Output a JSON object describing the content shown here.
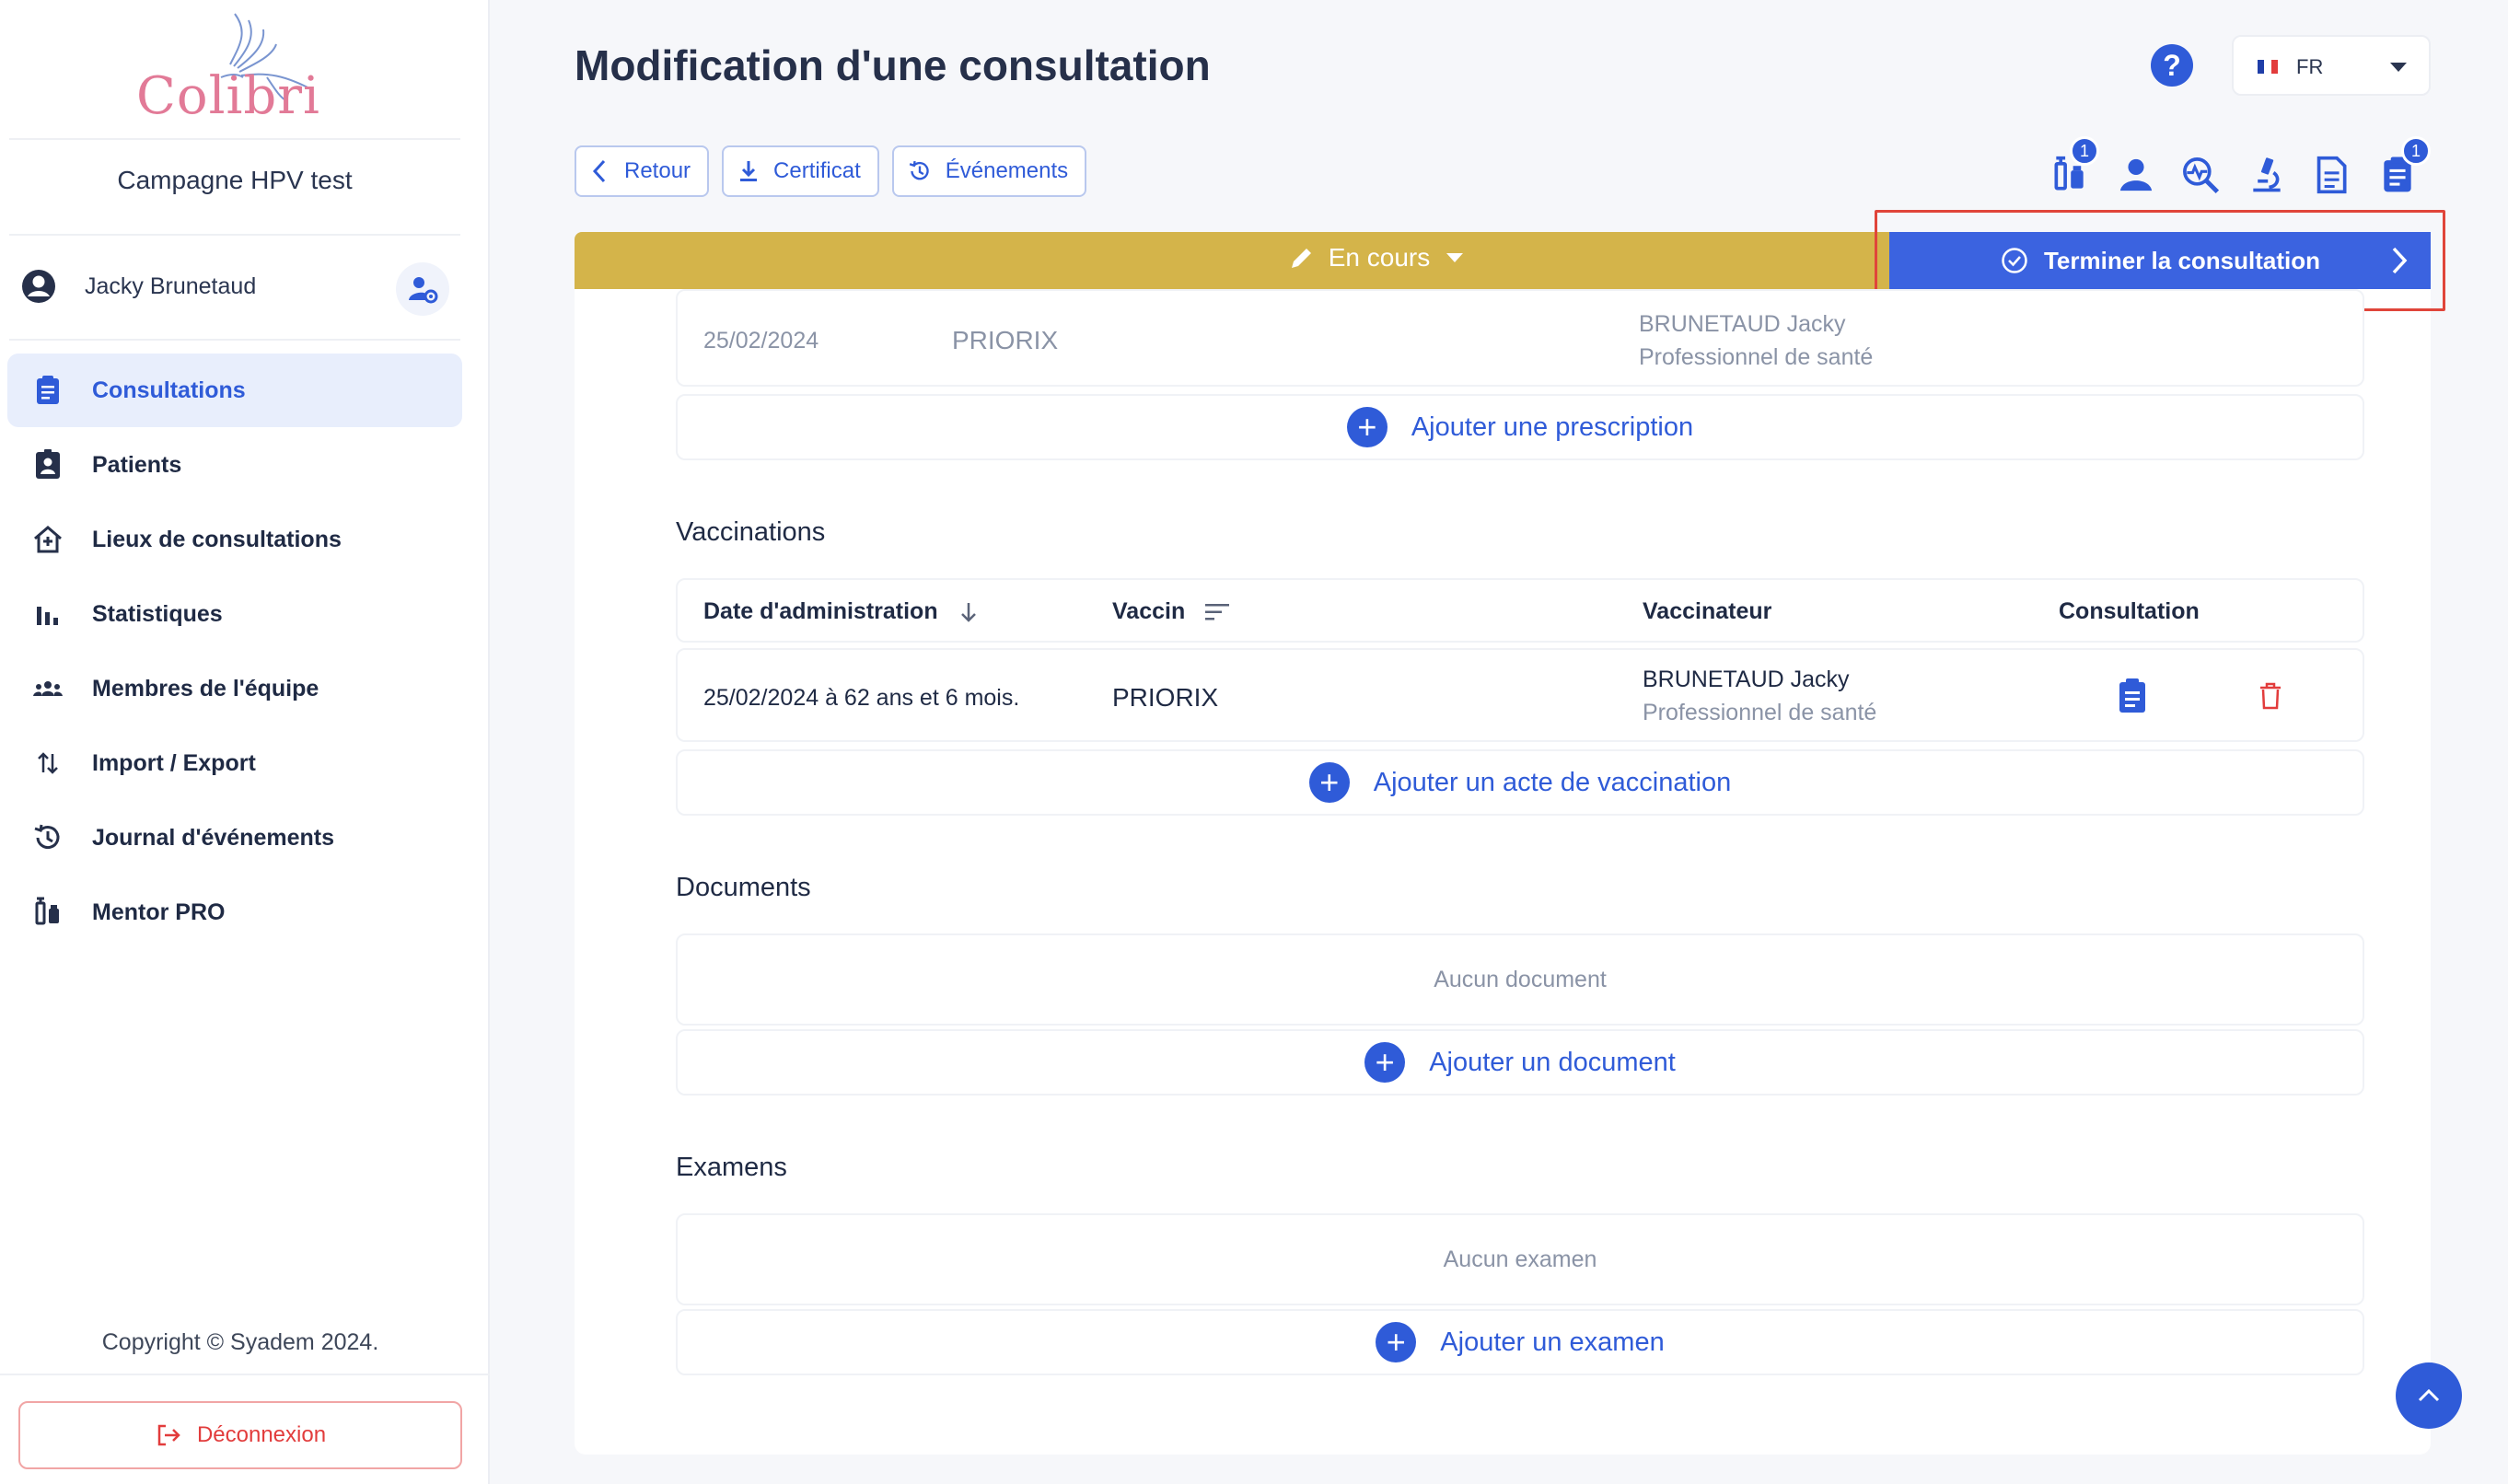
{
  "app": {
    "logo_text": "Colibri",
    "campaign": "Campagne HPV test"
  },
  "user": {
    "name": "Jacky Brunetaud"
  },
  "nav": {
    "items": [
      {
        "label": "Consultations",
        "icon": "clipboard-icon",
        "active": true
      },
      {
        "label": "Patients",
        "icon": "patient-badge-icon",
        "active": false
      },
      {
        "label": "Lieux de consultations",
        "icon": "house-plus-icon",
        "active": false
      },
      {
        "label": "Statistiques",
        "icon": "bar-chart-icon",
        "active": false
      },
      {
        "label": "Membres de l'équipe",
        "icon": "team-icon",
        "active": false
      },
      {
        "label": "Import / Export",
        "icon": "arrows-up-down-icon",
        "active": false
      },
      {
        "label": "Journal d'événements",
        "icon": "history-icon",
        "active": false
      },
      {
        "label": "Mentor PRO",
        "icon": "vaccine-icon",
        "active": false
      }
    ]
  },
  "footer": {
    "copyright": "Copyright © Syadem 2024.",
    "logout": "Déconnexion"
  },
  "header": {
    "title": "Modification d'une consultation",
    "help": "?",
    "language": "FR"
  },
  "toolbar": {
    "back": "Retour",
    "certificate": "Certificat",
    "events": "Événements"
  },
  "top_icons": {
    "vaccine_badge": "1",
    "document_badge": "1"
  },
  "status": {
    "label": "En cours",
    "finish": "Terminer la consultation"
  },
  "prescription": {
    "date": "25/02/2024",
    "vaccine": "PRIORIX",
    "prescriber": "BRUNETAUD Jacky",
    "role": "Professionnel de santé",
    "add": "Ajouter une prescription"
  },
  "vaccinations": {
    "title": "Vaccinations",
    "headers": {
      "date": "Date d'administration",
      "vaccine": "Vaccin",
      "vaccinator": "Vaccinateur",
      "consultation": "Consultation"
    },
    "rows": [
      {
        "date": "25/02/2024 à 62 ans et 6 mois.",
        "vaccine": "PRIORIX",
        "vaccinator": "BRUNETAUD Jacky",
        "role": "Professionnel de santé"
      }
    ],
    "add": "Ajouter un acte de vaccination"
  },
  "documents": {
    "title": "Documents",
    "empty": "Aucun document",
    "add": "Ajouter un document"
  },
  "exams": {
    "title": "Examens",
    "empty": "Aucun examen",
    "add": "Ajouter un examen"
  },
  "colors": {
    "accent": "#2f5bd8",
    "status_bar": "#d4b44a",
    "finish_button": "#3b63e0",
    "danger": "#e23c3c",
    "logo": "#e27a97"
  }
}
